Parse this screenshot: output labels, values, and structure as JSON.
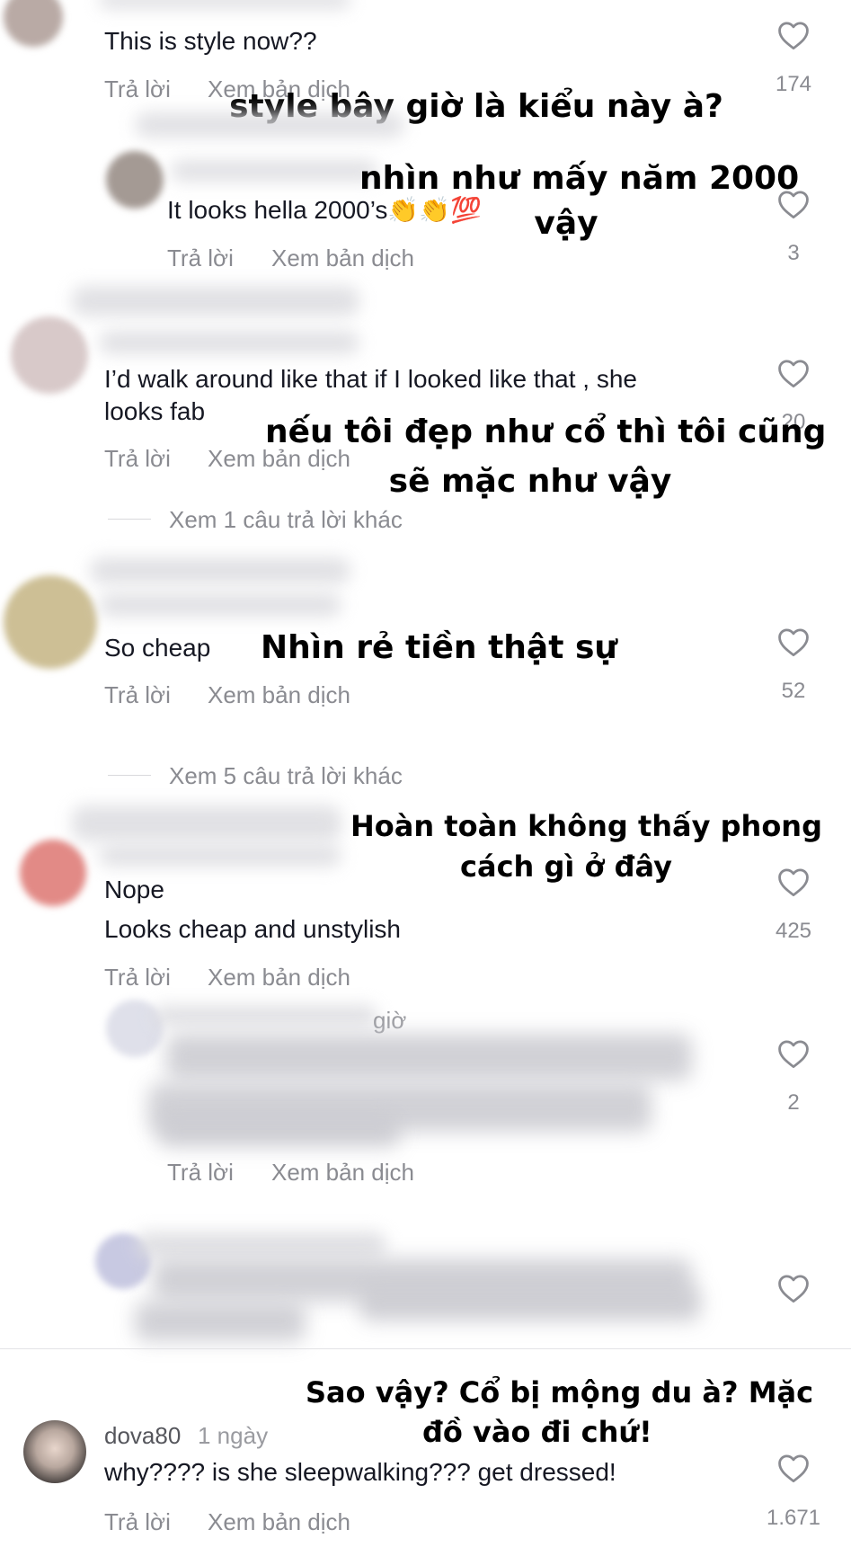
{
  "labels": {
    "reply": "Trả lời",
    "translate": "Xem bản dịch"
  },
  "comments": [
    {
      "text": "This is style now??",
      "likes": "174",
      "overlay": "style bây giờ là kiểu này à?"
    },
    {
      "text": "It looks hella 2000’s👏👏💯",
      "likes": "3",
      "overlay_line1": "nhìn như mấy năm 2000",
      "overlay_line2": "vậy"
    },
    {
      "text_line1": "I’d walk around like that if I looked like  that , she",
      "text_line2": "looks fab",
      "likes": "20",
      "overlay_line1": "nếu tôi đẹp như cổ thì tôi cũng",
      "overlay_line2": "sẽ mặc như vậy",
      "more_replies": "Xem 1 câu trả lời khác"
    },
    {
      "text": "So cheap",
      "likes": "52",
      "overlay": "Nhìn rẻ tiền thật sự",
      "more_replies": "Xem 5 câu trả lời khác"
    },
    {
      "text_line1": "Nope",
      "text_line2": "Looks cheap and unstylish",
      "likes": "425",
      "overlay_line1": "Hoàn toàn không thấy phong",
      "overlay_line2": "cách gì ở đây"
    },
    {
      "likes": "2",
      "partial_time": "giờ"
    },
    {
      "likes": ""
    },
    {
      "username": "dova80",
      "date": "1 ngày",
      "text": "why???? is she sleepwalking??? get dressed!",
      "likes": "1.671",
      "overlay_line1": "Sao vậy? Cổ bị mộng du à? Mặc",
      "overlay_line2": "đồ vào đi chứ!"
    }
  ]
}
